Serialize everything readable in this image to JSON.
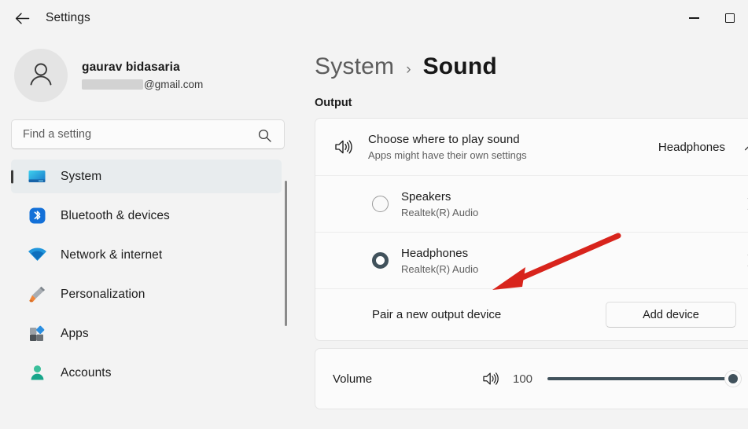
{
  "window": {
    "app_title": "Settings",
    "back_icon": "back-arrow-icon",
    "minimize_label": "Minimize",
    "maximize_label": "Maximize"
  },
  "sidebar": {
    "profile": {
      "name": "gaurav bidasaria",
      "email_suffix": "@gmail.com",
      "email_redacted": true,
      "avatar_icon": "person-icon"
    },
    "search": {
      "placeholder": "Find a setting",
      "value": "",
      "icon": "search-icon"
    },
    "items": [
      {
        "label": "System",
        "icon": "monitor-icon",
        "selected": true
      },
      {
        "label": "Bluetooth & devices",
        "icon": "bluetooth-icon",
        "selected": false
      },
      {
        "label": "Network & internet",
        "icon": "wifi-icon",
        "selected": false
      },
      {
        "label": "Personalization",
        "icon": "paintbrush-icon",
        "selected": false
      },
      {
        "label": "Apps",
        "icon": "apps-icon",
        "selected": false
      },
      {
        "label": "Accounts",
        "icon": "account-icon",
        "selected": false
      }
    ]
  },
  "content": {
    "breadcrumb": {
      "parent": "System",
      "separator": "›",
      "current": "Sound"
    },
    "section_output": "Output",
    "choose_row": {
      "icon": "speaker-icon",
      "title": "Choose where to play sound",
      "subtitle": "Apps might have their own settings",
      "value": "Headphones",
      "expand_icon": "chevron-up-icon"
    },
    "devices": [
      {
        "name": "Speakers",
        "driver": "Realtek(R) Audio",
        "selected": false,
        "chevron": "chevron-right-icon"
      },
      {
        "name": "Headphones",
        "driver": "Realtek(R) Audio",
        "selected": true,
        "chevron": "chevron-right-icon"
      }
    ],
    "pair_row": {
      "label": "Pair a new output device",
      "button": "Add device"
    },
    "volume_row": {
      "label": "Volume",
      "icon": "speaker-icon",
      "value": "100",
      "percent": 100
    }
  },
  "annotation": {
    "arrow_color": "#d8241c",
    "arrow_target": "Headphones"
  },
  "colors": {
    "page_background": "#f3f3f3",
    "card_background": "#fbfbfb",
    "selected_nav": "#e8ecee",
    "slider_fill": "#41525c",
    "accent_bluetooth": "#0f6cbd",
    "arrow_red": "#d8241c"
  }
}
